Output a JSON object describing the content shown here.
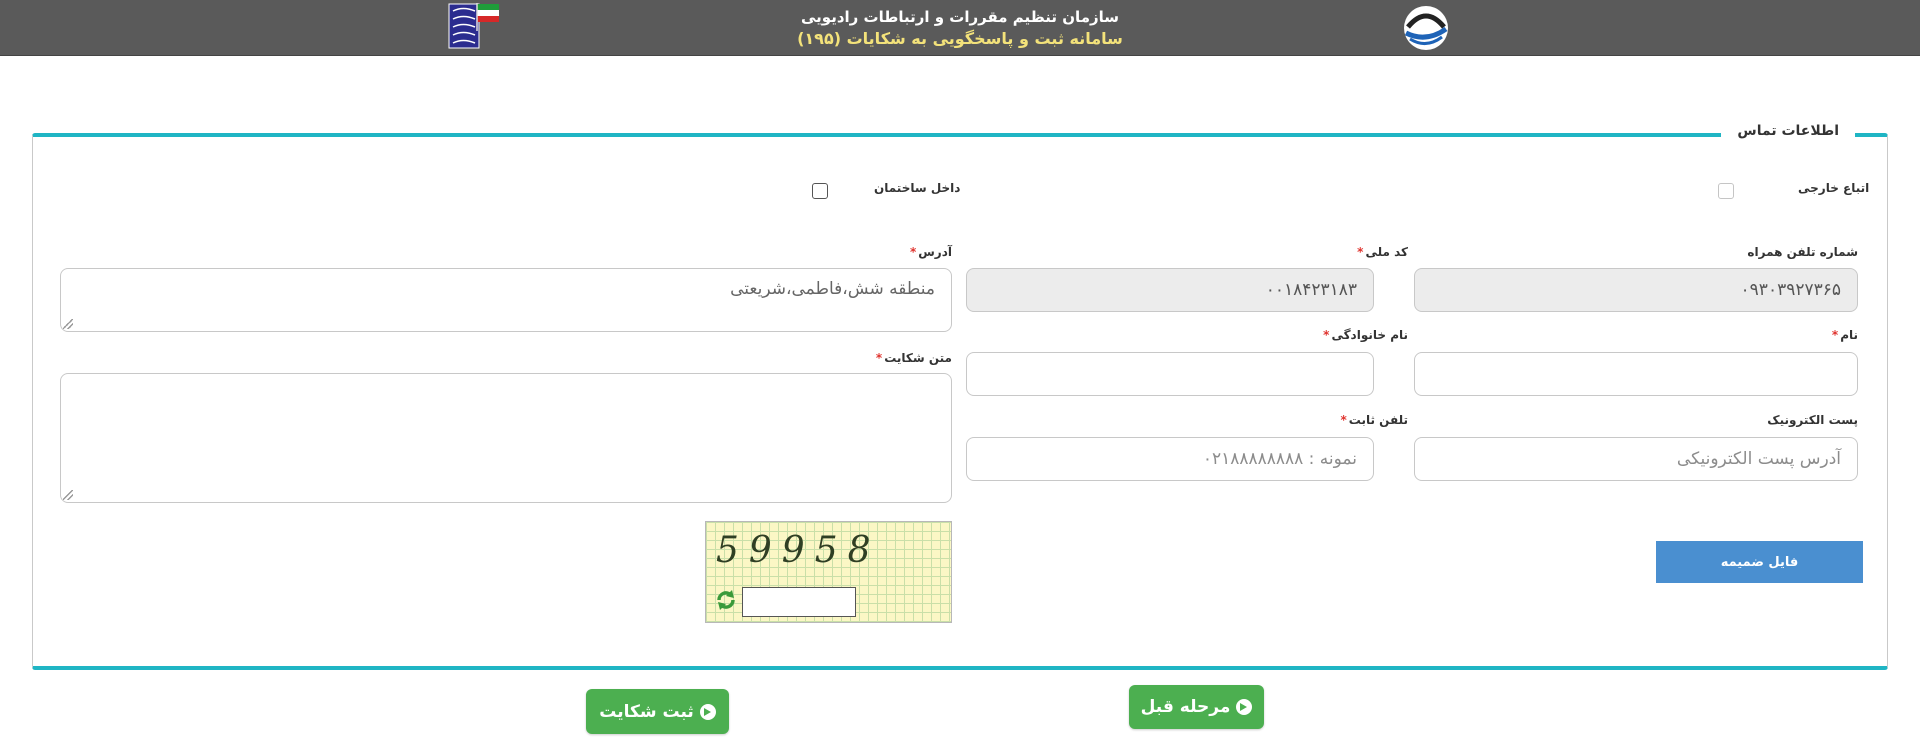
{
  "header": {
    "title_line1": "سازمان تنظیم مقررات و ارتباطات رادیویی",
    "title_line2": "سامانه ثبت و پاسخگویی به شکایات (۱۹۵)"
  },
  "section": {
    "legend": "اطلاعات تماس"
  },
  "checkboxes": {
    "foreign_national": {
      "label": "اتباع خارجی",
      "checked": false
    },
    "inside_building": {
      "label": "داخل ساختمان",
      "checked": false
    }
  },
  "fields": {
    "mobile": {
      "label": "شماره تلفن همراه",
      "value": "۰۹۳۰۳۹۲۷۳۶۵"
    },
    "national_code": {
      "label": "کد ملی",
      "value": "۰۰۱۸۴۲۳۱۸۳"
    },
    "address": {
      "label": "آدرس",
      "value": "منطقه شش،فاطمی،شریعتی"
    },
    "first_name": {
      "label": "نام",
      "value": ""
    },
    "last_name": {
      "label": "نام خانوادگی",
      "value": ""
    },
    "complaint_text": {
      "label": "متن شکایت",
      "value": ""
    },
    "email": {
      "label": "پست الکترونیک",
      "placeholder": "آدرس پست الکترونیکی"
    },
    "landline": {
      "label": "تلفن ثابت",
      "placeholder": "نمونه : ۰۲۱۸۸۸۸۸۸۸۸"
    }
  },
  "required_mark": "*",
  "attach_button": "فایل ضمیمه",
  "captcha": {
    "code": "59958"
  },
  "buttons": {
    "submit": "ثبت شکایت",
    "previous": "مرحله قبل"
  },
  "colors": {
    "header_bg": "#5a5a5a",
    "header_subtitle": "#f3e27a",
    "panel_border": "#1fb5c4",
    "attach_bg": "#4a8fd0",
    "button_green": "#4caf50",
    "required": "#e0342f"
  },
  "icons": {
    "left_logo": "iran-flag-emblem-icon",
    "right_logo": "cra-logo-icon",
    "refresh": "refresh-icon",
    "arrow": "arrow-right-circle-icon"
  }
}
